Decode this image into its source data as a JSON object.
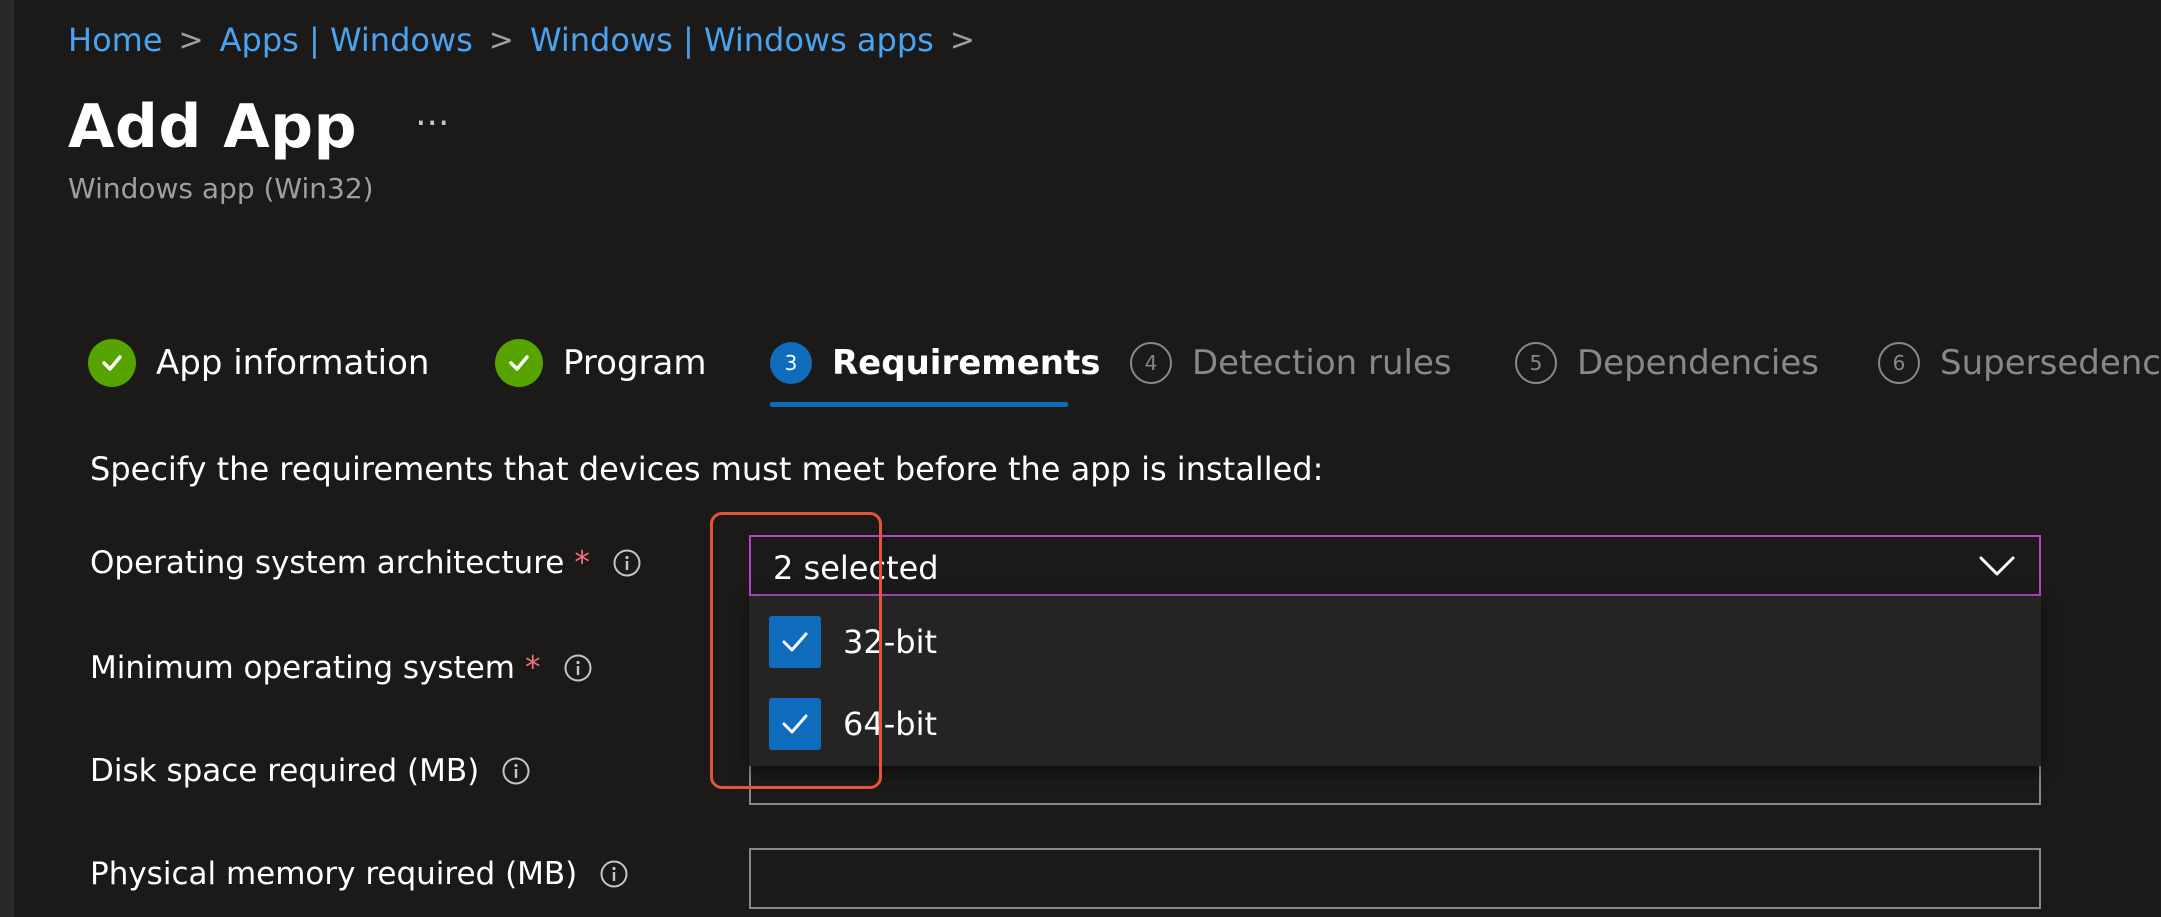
{
  "breadcrumb": {
    "items": [
      "Home",
      "Apps | Windows",
      "Windows | Windows apps"
    ],
    "separator": ">"
  },
  "header": {
    "title": "Add App",
    "more_label": "···",
    "subtitle": "Windows app (Win32)"
  },
  "tabs": [
    {
      "label": "App information",
      "state": "done",
      "number": ""
    },
    {
      "label": "Program",
      "state": "done",
      "number": ""
    },
    {
      "label": "Requirements",
      "state": "active",
      "number": "3"
    },
    {
      "label": "Detection rules",
      "state": "pending",
      "number": "4"
    },
    {
      "label": "Dependencies",
      "state": "pending",
      "number": "5"
    },
    {
      "label": "Supersedence",
      "state": "pending",
      "number": "6"
    }
  ],
  "form": {
    "intro": "Specify the requirements that devices must meet before the app is installed:",
    "required_mark": "*",
    "fields": [
      {
        "label": "Operating system architecture",
        "required": true,
        "value": "2 selected"
      },
      {
        "label": "Minimum operating system",
        "required": true,
        "value": ""
      },
      {
        "label": "Disk space required (MB)",
        "required": false,
        "value": ""
      },
      {
        "label": "Physical memory required (MB)",
        "required": false,
        "value": ""
      }
    ],
    "architecture_options": [
      {
        "label": "32-bit",
        "checked": true
      },
      {
        "label": "64-bit",
        "checked": true
      }
    ]
  },
  "colors": {
    "background": "#1b1a19",
    "link": "#4aa3f0",
    "accent": "#0f6cbd",
    "success": "#57a300",
    "focus_border": "#b146c2",
    "highlight_annotation": "#e3543a",
    "required": "#f1707b"
  },
  "icons": [
    "chevron-right-icon",
    "more-icon",
    "checkmark-icon",
    "info-icon",
    "chevron-down-icon"
  ]
}
